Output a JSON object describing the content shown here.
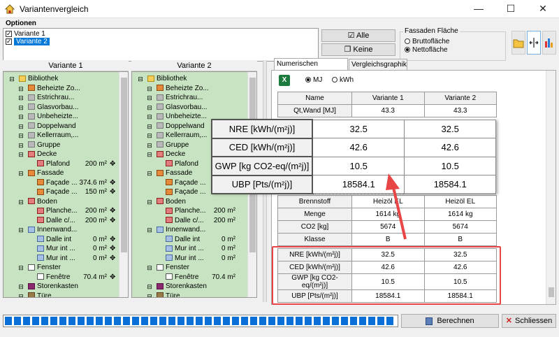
{
  "window": {
    "title": "Variantenvergleich",
    "minimize": "—",
    "maximize": "☐",
    "close": "✕"
  },
  "options": {
    "label": "Optionen",
    "variants": [
      {
        "label": "Variante 1",
        "checked": true,
        "selected": false
      },
      {
        "label": "Variante 2",
        "checked": true,
        "selected": true
      }
    ],
    "btn_all": "Alle",
    "btn_none": "Keine",
    "facade_group": {
      "label": "Fassaden Fläche",
      "options": [
        "Bruttofläche",
        "Nettofläche"
      ],
      "selected": "Nettofläche"
    }
  },
  "columns": {
    "v1": "Variante 1",
    "v2": "Variante 2"
  },
  "tree1": [
    {
      "label": "Bibliothek",
      "icon": "folder-icon",
      "level": 0,
      "value": ""
    },
    {
      "label": "Beheizte Zo...",
      "icon": "zone-icon",
      "level": 1,
      "value": ""
    },
    {
      "label": "Estrichrau...",
      "icon": "room-icon",
      "level": 1,
      "value": ""
    },
    {
      "label": "Glasvorbau...",
      "icon": "room-icon",
      "level": 1,
      "value": ""
    },
    {
      "label": "Unbeheizte...",
      "icon": "room-icon",
      "level": 1,
      "value": ""
    },
    {
      "label": "Doppelwand",
      "icon": "room-icon",
      "level": 1,
      "value": ""
    },
    {
      "label": "Kellerraum,...",
      "icon": "room-icon",
      "level": 1,
      "value": ""
    },
    {
      "label": "Gruppe",
      "icon": "room-icon",
      "level": 1,
      "value": ""
    },
    {
      "label": "Decke",
      "icon": "ceiling-icon",
      "level": 1,
      "value": ""
    },
    {
      "label": "Plafond",
      "icon": "ceiling-icon",
      "level": 2,
      "value": "200 m²"
    },
    {
      "label": "Fassade",
      "icon": "facade-icon",
      "level": 1,
      "value": ""
    },
    {
      "label": "Façade ...",
      "icon": "facade-icon",
      "level": 2,
      "value": "374.6 m²"
    },
    {
      "label": "Façade ...",
      "icon": "facade-icon",
      "level": 2,
      "value": "150 m²"
    },
    {
      "label": "Boden",
      "icon": "floor-icon",
      "level": 1,
      "value": ""
    },
    {
      "label": "Planche...",
      "icon": "floor-icon",
      "level": 2,
      "value": "200 m²"
    },
    {
      "label": "Dalle c/...",
      "icon": "floor-icon",
      "level": 2,
      "value": "200 m²"
    },
    {
      "label": "Innenwand...",
      "icon": "wall-icon",
      "level": 1,
      "value": ""
    },
    {
      "label": "Dalle int",
      "icon": "wall-icon",
      "level": 2,
      "value": "0 m²"
    },
    {
      "label": "Mur int ...",
      "icon": "wall-icon",
      "level": 2,
      "value": "0 m²"
    },
    {
      "label": "Mur int ...",
      "icon": "wall-icon",
      "level": 2,
      "value": "0 m²"
    },
    {
      "label": "Fenster",
      "icon": "window-icon",
      "level": 1,
      "value": ""
    },
    {
      "label": "Fenêtre",
      "icon": "window-icon",
      "level": 2,
      "value": "70.4 m²"
    },
    {
      "label": "Storenkasten",
      "icon": "shutter-box-icon",
      "level": 1,
      "value": ""
    },
    {
      "label": "Türe",
      "icon": "door-icon",
      "level": 1,
      "value": ""
    }
  ],
  "tree2": [
    {
      "label": "Bibliothek",
      "icon": "folder-icon",
      "level": 0,
      "value": ""
    },
    {
      "label": "Beheizte Zo...",
      "icon": "zone-icon",
      "level": 1,
      "value": ""
    },
    {
      "label": "Estrichrau...",
      "icon": "room-icon",
      "level": 1,
      "value": ""
    },
    {
      "label": "Glasvorbau...",
      "icon": "room-icon",
      "level": 1,
      "value": ""
    },
    {
      "label": "Unbeheizte...",
      "icon": "room-icon",
      "level": 1,
      "value": ""
    },
    {
      "label": "Doppelwand",
      "icon": "room-icon",
      "level": 1,
      "value": ""
    },
    {
      "label": "Kellerraum,...",
      "icon": "room-icon",
      "level": 1,
      "value": ""
    },
    {
      "label": "Gruppe",
      "icon": "room-icon",
      "level": 1,
      "value": ""
    },
    {
      "label": "Decke",
      "icon": "ceiling-icon",
      "level": 1,
      "value": ""
    },
    {
      "label": "Plafond",
      "icon": "ceiling-icon",
      "level": 2,
      "value": ""
    },
    {
      "label": "Fassade",
      "icon": "facade-icon",
      "level": 1,
      "value": ""
    },
    {
      "label": "Façade ...",
      "icon": "facade-icon",
      "level": 2,
      "value": ""
    },
    {
      "label": "Façade ...",
      "icon": "facade-icon",
      "level": 2,
      "value": ""
    },
    {
      "label": "Boden",
      "icon": "floor-icon",
      "level": 1,
      "value": ""
    },
    {
      "label": "Planche...",
      "icon": "floor-icon",
      "level": 2,
      "value": "200 m²"
    },
    {
      "label": "Dalle c/...",
      "icon": "floor-icon",
      "level": 2,
      "value": "200 m²"
    },
    {
      "label": "Innenwand...",
      "icon": "wall-icon",
      "level": 1,
      "value": ""
    },
    {
      "label": "Dalle int",
      "icon": "wall-icon",
      "level": 2,
      "value": "0 m²"
    },
    {
      "label": "Mur int ...",
      "icon": "wall-icon",
      "level": 2,
      "value": "0 m²"
    },
    {
      "label": "Mur int ...",
      "icon": "wall-icon",
      "level": 2,
      "value": "0 m²"
    },
    {
      "label": "Fenster",
      "icon": "window-icon",
      "level": 1,
      "value": ""
    },
    {
      "label": "Fenêtre",
      "icon": "window-icon",
      "level": 2,
      "value": "70.4 m²"
    },
    {
      "label": "Storenkasten",
      "icon": "shutter-box-icon",
      "level": 1,
      "value": ""
    },
    {
      "label": "Türe",
      "icon": "door-icon",
      "level": 1,
      "value": ""
    }
  ],
  "tabs": [
    "Numerischen Ergebnisse",
    "Vergleichsgraphik"
  ],
  "units": {
    "options": [
      "MJ",
      "kWh"
    ],
    "selected": "MJ"
  },
  "results": {
    "head": [
      "Name",
      "Variante 1",
      "Variante 2"
    ],
    "top_rows": [
      [
        "Qt,Wand [MJ]",
        "43.3",
        "43.3"
      ]
    ],
    "fuel_rows": [
      [
        "Brennstoff",
        "Heizöl EL",
        "Heizöl EL"
      ],
      [
        "Menge",
        "1614 kg",
        "1614 kg"
      ],
      [
        "CO2 [kg]",
        "5674",
        "5674"
      ],
      [
        "Klasse",
        "B",
        "B"
      ]
    ],
    "indicator_rows": [
      [
        "NRE [kWh/(m²j)]",
        "32.5",
        "32.5"
      ],
      [
        "CED [kWh/(m²j)]",
        "42.6",
        "42.6"
      ],
      [
        "GWP [kg CO2-eq/(m²j)]",
        "10.5",
        "10.5"
      ],
      [
        "UBP [Pts/(m²j)]",
        "18584.1",
        "18584.1"
      ]
    ]
  },
  "footer": {
    "calculate": "Berechnen",
    "close": "Schliessen"
  }
}
